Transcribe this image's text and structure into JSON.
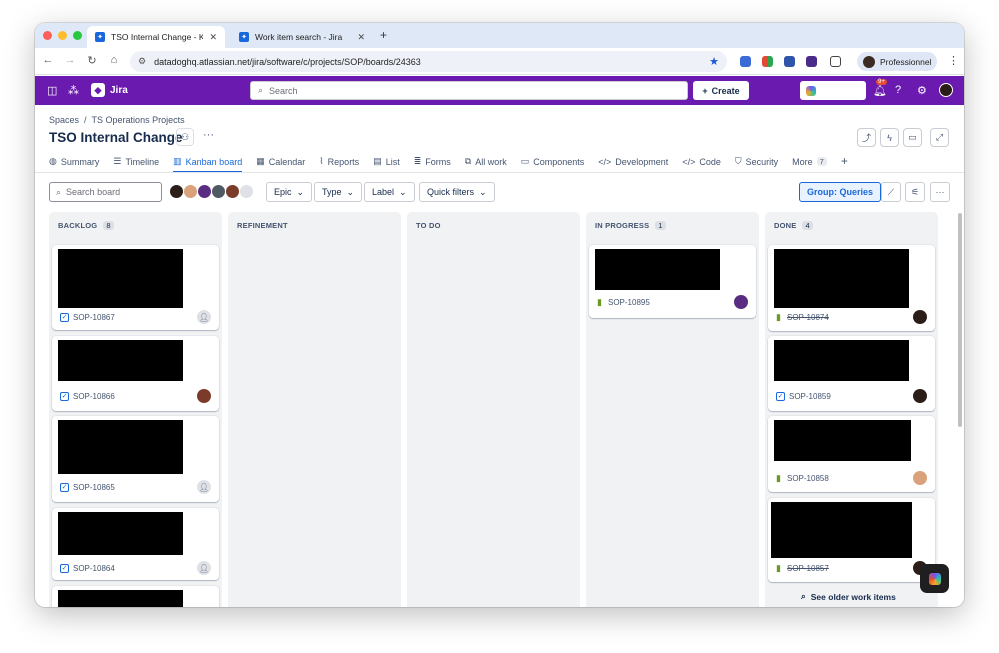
{
  "browser": {
    "tabs": [
      {
        "title": "TSO Internal Change - Kanban board - Jira",
        "active": true
      },
      {
        "title": "Work item search - Jira",
        "active": false
      }
    ],
    "url": "datadoghq.atlassian.net/jira/software/c/projects/SOP/boards/24363",
    "profile_label": "Professionnel"
  },
  "topnav": {
    "product": "Jira",
    "search_placeholder": "Search",
    "create_label": "Create",
    "notif_badge": "9+"
  },
  "breadcrumb": [
    "Spaces",
    "/",
    "TS Operations Projects"
  ],
  "page_title": "TSO Internal Change",
  "tabs": [
    {
      "label": "Summary",
      "icon": "globe-icon"
    },
    {
      "label": "Timeline",
      "icon": "timeline-icon"
    },
    {
      "label": "Kanban board",
      "icon": "board-icon",
      "active": true
    },
    {
      "label": "Calendar",
      "icon": "calendar-icon"
    },
    {
      "label": "Reports",
      "icon": "reports-icon"
    },
    {
      "label": "List",
      "icon": "list-icon"
    },
    {
      "label": "Forms",
      "icon": "forms-icon"
    },
    {
      "label": "All work",
      "icon": "all-work-icon"
    },
    {
      "label": "Components",
      "icon": "components-icon"
    },
    {
      "label": "Development",
      "icon": "code-brackets-icon"
    },
    {
      "label": "Code",
      "icon": "code-icon"
    },
    {
      "label": "Security",
      "icon": "shield-icon"
    },
    {
      "label": "More",
      "count": "7"
    }
  ],
  "filters": {
    "search_placeholder": "Search board",
    "epic": "Epic",
    "type": "Type",
    "label": "Label",
    "quick_filters": "Quick filters",
    "group": "Group: Queries"
  },
  "columns": [
    {
      "name": "BACKLOG",
      "count": "8",
      "cards": [
        {
          "key": "SOP-10867",
          "type": "task",
          "done": false,
          "assignee": "unassigned"
        },
        {
          "key": "SOP-10866",
          "type": "task",
          "done": false,
          "assignee": "user"
        },
        {
          "key": "SOP-10865",
          "type": "task",
          "done": false,
          "assignee": "unassigned"
        },
        {
          "key": "SOP-10864",
          "type": "task",
          "done": false,
          "assignee": "unassigned"
        }
      ]
    },
    {
      "name": "REFINEMENT",
      "count": "",
      "cards": []
    },
    {
      "name": "TO DO",
      "count": "",
      "cards": []
    },
    {
      "name": "IN PROGRESS",
      "count": "1",
      "cards": [
        {
          "key": "SOP-10895",
          "type": "story",
          "done": false,
          "assignee": "user"
        }
      ]
    },
    {
      "name": "DONE",
      "count": "4",
      "cards": [
        {
          "key": "SOP-10874",
          "type": "story",
          "done": true,
          "assignee": "user"
        },
        {
          "key": "SOP-10859",
          "type": "task",
          "done": false,
          "assignee": "user"
        },
        {
          "key": "SOP-10858",
          "type": "story",
          "done": false,
          "assignee": "user"
        },
        {
          "key": "SOP-10857",
          "type": "story",
          "done": true,
          "assignee": "user"
        }
      ]
    }
  ],
  "see_older": "See older work items",
  "colors": {
    "brand": "#6a1aae",
    "accent": "#1868db",
    "column_bg": "#f1f2f4"
  }
}
